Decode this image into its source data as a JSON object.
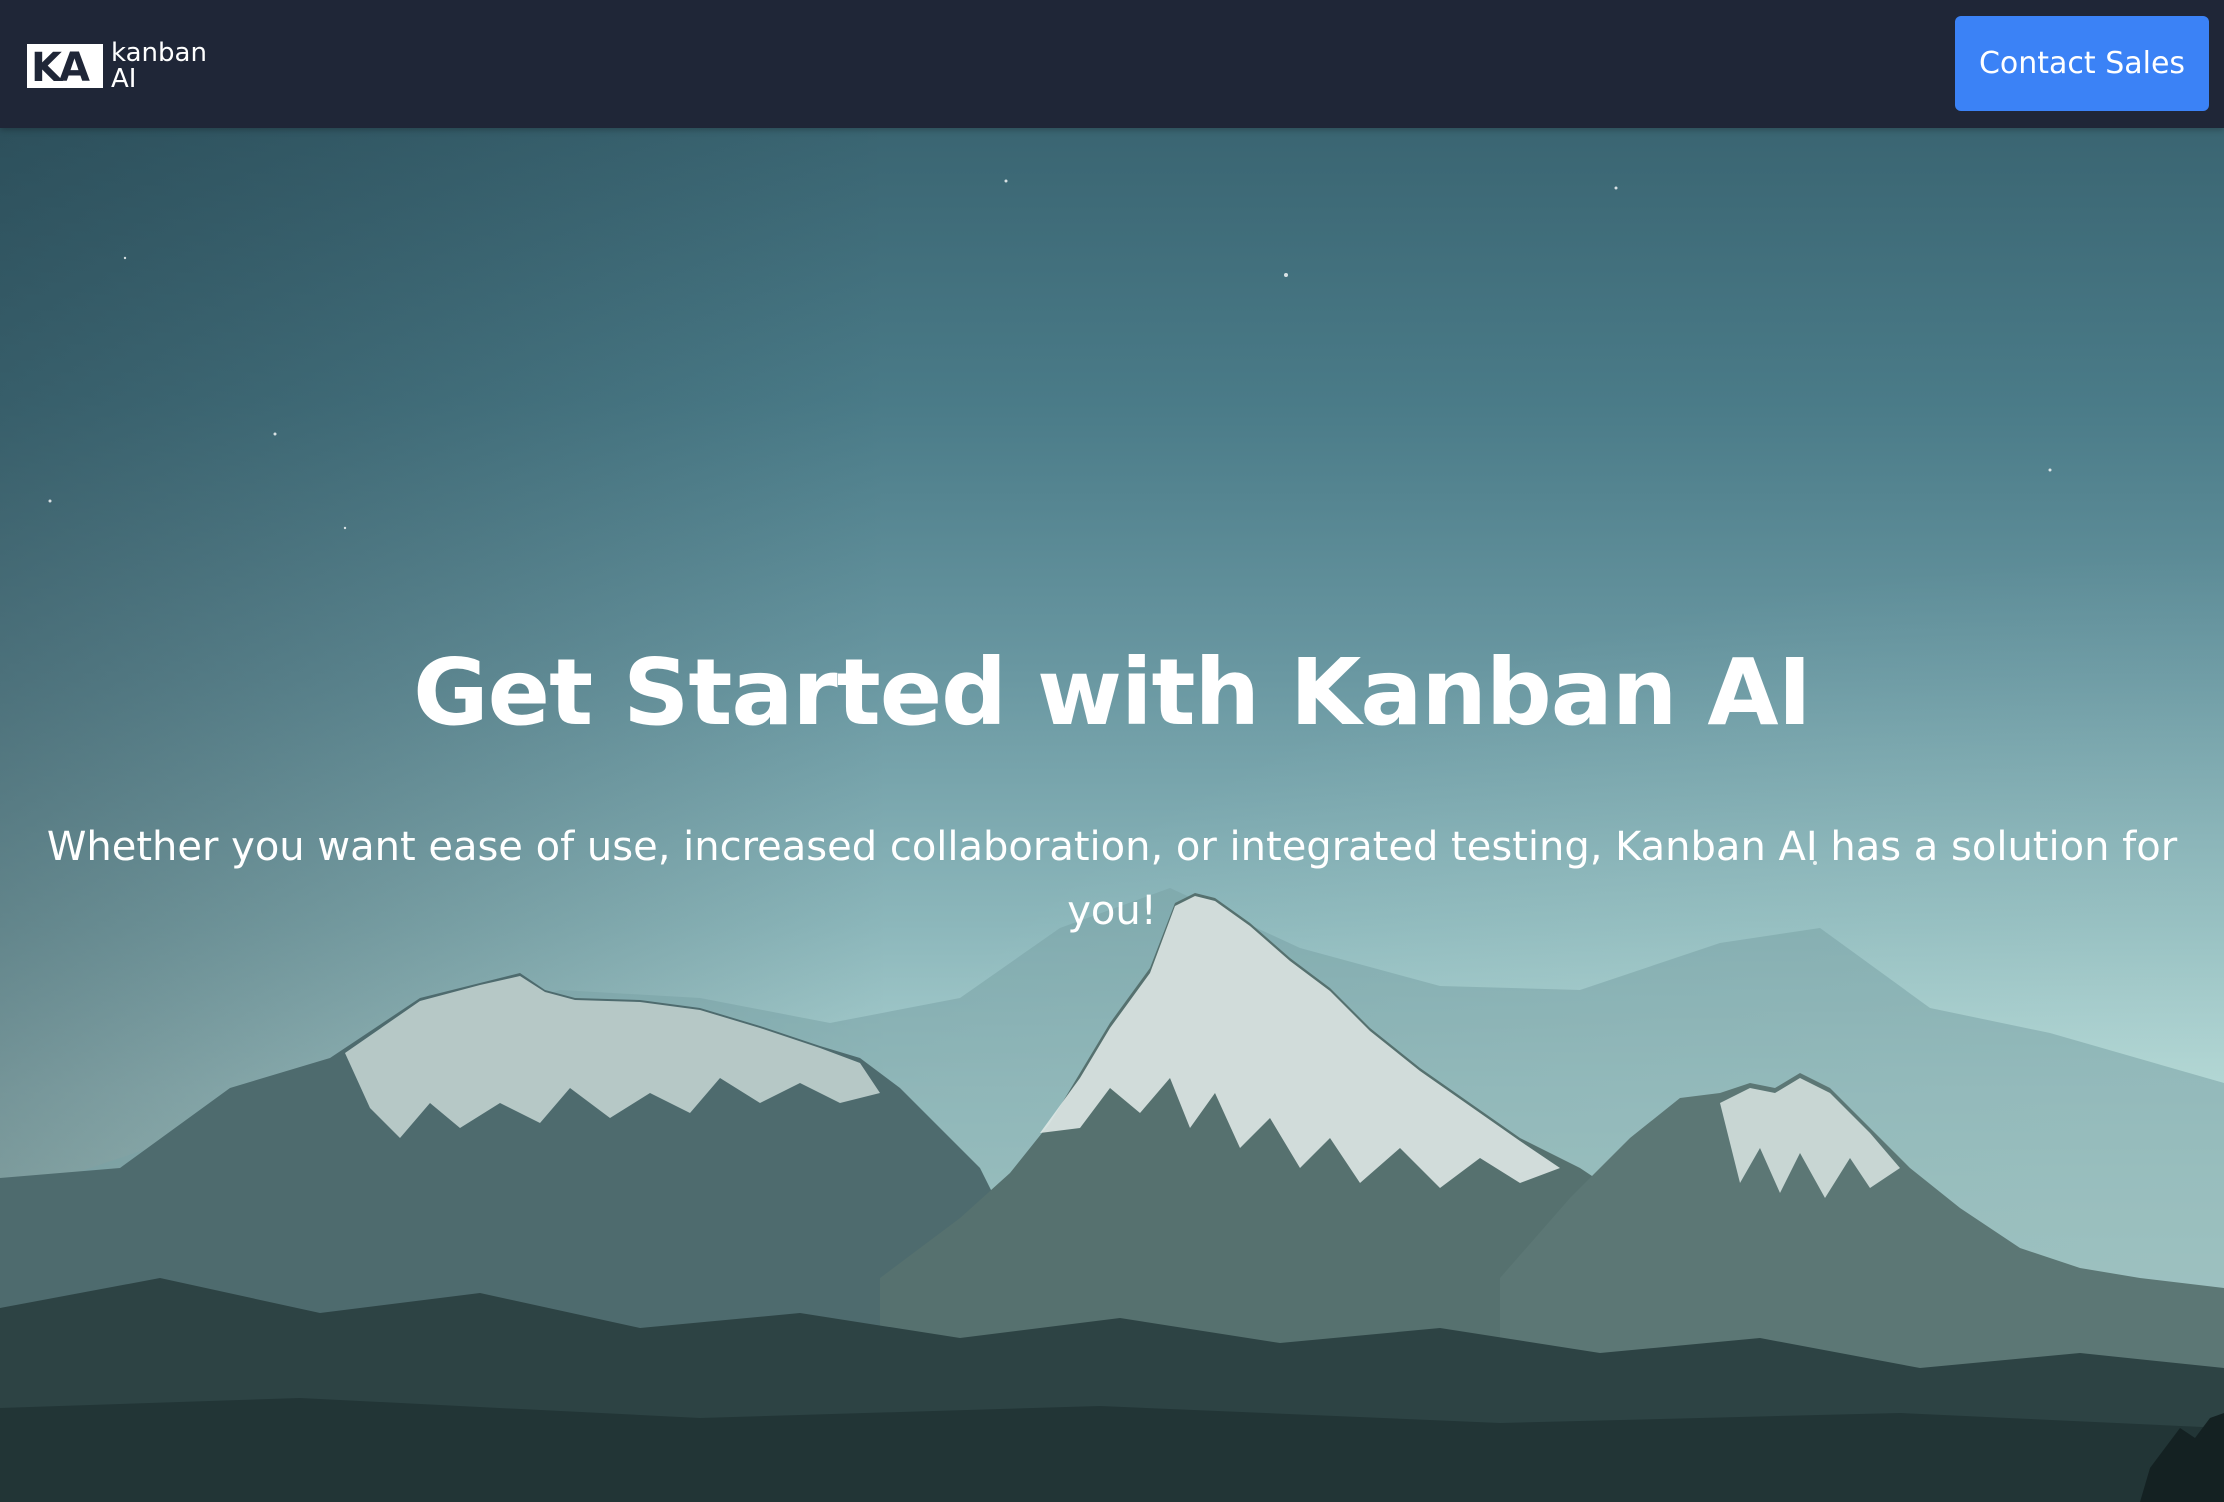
{
  "header": {
    "logo_mark": "KA",
    "logo_word_1": "kanban",
    "logo_word_2": "AI",
    "cta_label": "Contact Sales"
  },
  "hero": {
    "title": "Get Started with Kanban AI",
    "subtitle": "Whether you want ease of use, increased collaboration, or integrated testing, Kanban AI has a solution for you!"
  },
  "colors": {
    "header_bg": "#1f2637",
    "cta_bg": "#3b82f6",
    "text": "#ffffff"
  }
}
